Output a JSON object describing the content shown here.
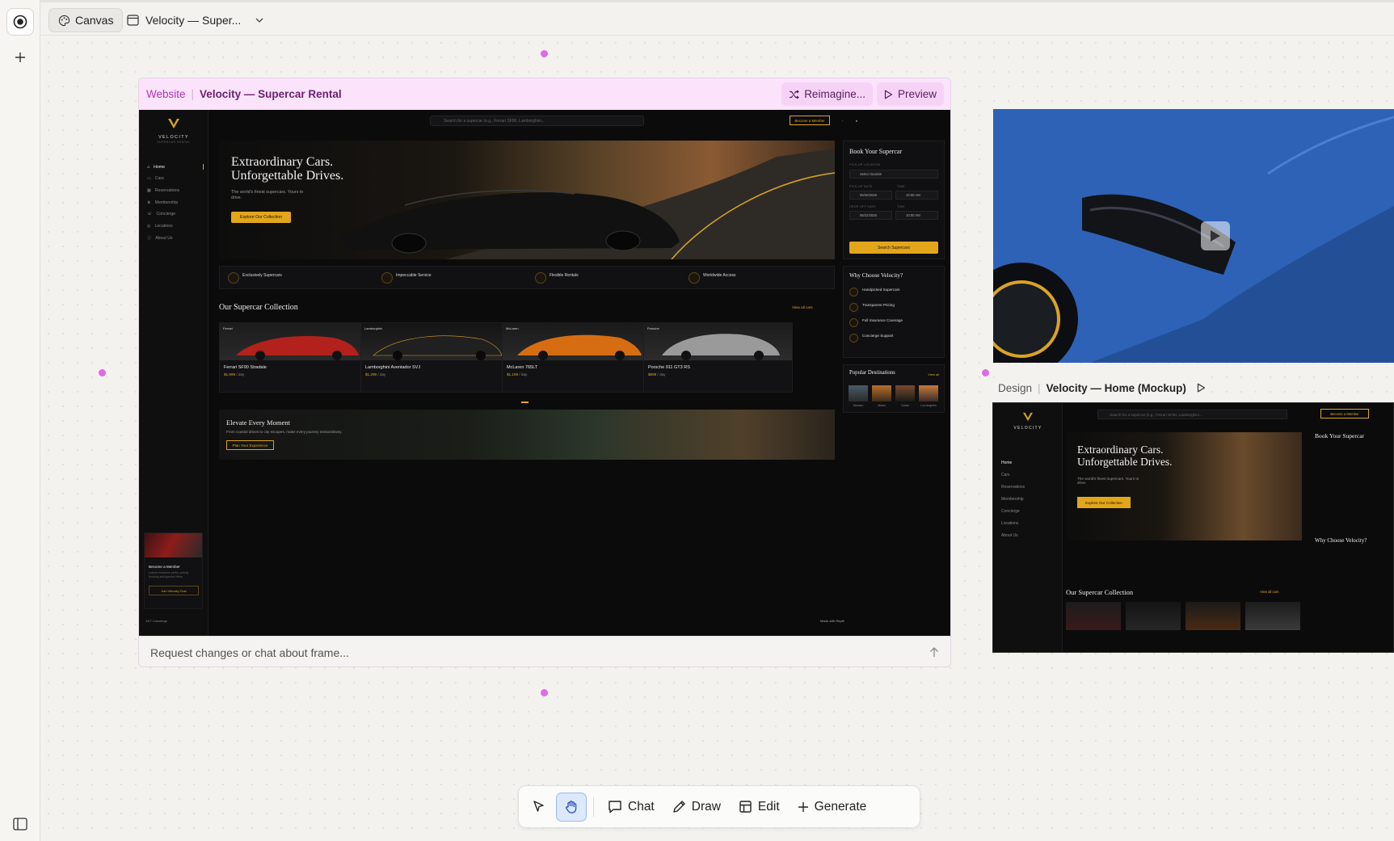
{
  "app": {
    "canvas_label": "Canvas",
    "project_name": "Velocity — Super..."
  },
  "frame": {
    "tag": "Website",
    "title": "Velocity — Supercar Rental",
    "reimagine": "Reimagine...",
    "preview": "Preview",
    "chat_placeholder": "Request changes or chat about frame..."
  },
  "design": {
    "tag": "Design",
    "title": "Velocity — Home (Mockup)"
  },
  "toolbar": {
    "chat": "Chat",
    "draw": "Draw",
    "edit": "Edit",
    "generate": "Generate"
  },
  "site": {
    "brand": "VELOCITY",
    "tagline": "SUPERCAR RENTAL",
    "search_placeholder": "Search for a supercar (e.g., Ferrari SF90, Lamborghini...",
    "member_button": "Become a Member",
    "nav": [
      "Home",
      "Cars",
      "Reservations",
      "Membership",
      "Concierge",
      "Locations",
      "About Us"
    ],
    "hero": {
      "line1": "Extraordinary Cars.",
      "line2": "Unforgettable Drives.",
      "sub": "The world's finest supercars. Yours to drive.",
      "cta": "Explore Our Collection"
    },
    "features": [
      "Exclusively Supercars",
      "Impeccable Service",
      "Flexible Rentals",
      "Worldwide Access"
    ],
    "collection_title": "Our Supercar Collection",
    "view_all": "View all cars",
    "cars": [
      {
        "badge": "Ferrari",
        "name": "Ferrari SF90 Stradale",
        "price": "$1,899",
        "unit": "/ day"
      },
      {
        "badge": "Lamborghini",
        "name": "Lamborghini Aventador SVJ",
        "price": "$1,299",
        "unit": "/ day"
      },
      {
        "badge": "McLaren",
        "name": "McLaren 765LT",
        "price": "$1,199",
        "unit": "/ day"
      },
      {
        "badge": "Porsche",
        "name": "Porsche 911 GT3 RS",
        "price": "$899",
        "unit": "/ day"
      }
    ],
    "elevate": {
      "title": "Elevate Every Moment",
      "sub": "From coastal drives to city escapes, make every journey extraordinary.",
      "cta": "Plan Your Experience"
    },
    "book": {
      "title": "Book Your Supercar",
      "pickup_loc": "PICK-UP LOCATION",
      "location": "Select location",
      "pickup_date": "PICK-UP DATE",
      "time": "TIME",
      "date1": "05/20/2026",
      "time1": "10:00 AM",
      "dropoff_date": "DROP-OFF DATE",
      "date2": "05/22/2026",
      "time2": "10:00 AM",
      "cta": "Search Supercars"
    },
    "why": {
      "title": "Why Choose Velocity?",
      "items": [
        "Handpicked Supercars",
        "Transparent Pricing",
        "Full Insurance Coverage",
        "Concierge Support"
      ]
    },
    "destinations": {
      "title": "Popular Destinations",
      "view_all": "View all",
      "items": [
        "Monaco",
        "Miami",
        "Dubai",
        "Los Angeles"
      ]
    },
    "member_card": {
      "title": "Become a Member",
      "sub": "Unlock exclusive perks, priority booking and special offers.",
      "cta": "Join Velocity Club"
    },
    "concierge": "24/7 Concierge",
    "made_with": "Made with Replit"
  },
  "colors": {
    "accent": "#e3a61b",
    "frame_header": "#fbe3fb",
    "handle": "#e06ae6",
    "active_tool": "#dce8fb"
  },
  "icons": [
    "record-icon",
    "plus-icon",
    "palette-icon",
    "window-icon",
    "chevron-down-icon",
    "shuffle-icon",
    "play-icon",
    "send-arrow-icon",
    "pointer-icon",
    "hand-icon",
    "chat-icon",
    "pencil-icon",
    "edit-layout-icon",
    "plus-icon",
    "sidebar-toggle-icon"
  ]
}
